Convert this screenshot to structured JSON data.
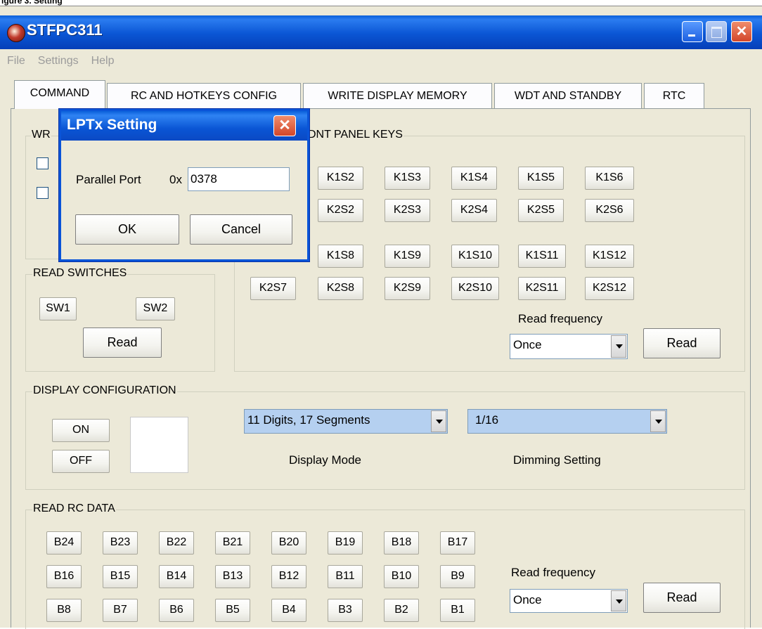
{
  "caption": "igure 3. Setting",
  "window": {
    "title": "STFPC311"
  },
  "menu": [
    "File",
    "Settings",
    "Help"
  ],
  "tabs": [
    "COMMAND",
    "RC AND HOTKEYS CONFIG",
    "WRITE DISPLAY MEMORY",
    "WDT AND STANDBY",
    "RTC"
  ],
  "write_group": {
    "label": "WR"
  },
  "front_panel": {
    "label": "DNT PANEL KEYS",
    "rows": [
      [
        "K1S2",
        "K1S3",
        "K1S4",
        "K1S5",
        "K1S6"
      ],
      [
        "K2S2",
        "K2S3",
        "K2S4",
        "K2S5",
        "K2S6"
      ],
      [
        "K1S8",
        "K1S9",
        "K1S10",
        "K1S11",
        "K1S12"
      ],
      [
        "K2S7",
        "K2S8",
        "K2S9",
        "K2S10",
        "K2S11",
        "K2S12"
      ]
    ],
    "read_frequency_label": "Read frequency",
    "read_frequency_value": "Once",
    "read_label": "Read"
  },
  "read_switches": {
    "label": "READ SWITCHES",
    "sw1": "SW1",
    "sw2": "SW2",
    "read_label": "Read"
  },
  "display_config": {
    "label": "DISPLAY CONFIGURATION",
    "on_label": "ON",
    "off_label": "OFF",
    "mode_value": "11 Digits, 17 Segments",
    "mode_label": "Display Mode",
    "dimming_value": "1/16",
    "dimming_label": "Dimming Setting"
  },
  "read_rc": {
    "label": "READ RC DATA",
    "rows": [
      [
        "B24",
        "B23",
        "B22",
        "B21",
        "B20",
        "B19",
        "B18",
        "B17"
      ],
      [
        "B16",
        "B15",
        "B14",
        "B13",
        "B12",
        "B11",
        "B10",
        "B9"
      ],
      [
        "B8",
        "B7",
        "B6",
        "B5",
        "B4",
        "B3",
        "B2",
        "B1"
      ]
    ],
    "read_frequency_label": "Read frequency",
    "read_frequency_value": "Once",
    "read_label": "Read"
  },
  "dialog": {
    "title": "LPTx Setting",
    "port_label": "Parallel Port",
    "prefix": "0x",
    "port_value": "0378",
    "ok_label": "OK",
    "cancel_label": "Cancel"
  },
  "colors": {
    "titlebar": "#0a55d4",
    "face": "#ece9d8",
    "close": "#d2462a",
    "selection": "#b5d0f0"
  }
}
